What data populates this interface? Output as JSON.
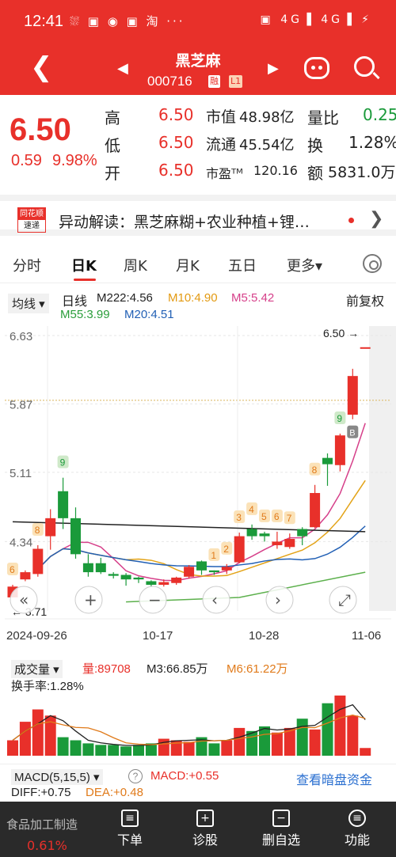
{
  "status": {
    "time": "12:41",
    "icons": "⛆ ▣ ◉ ▣ 淘 ···",
    "right": "▣ 4G▐ 4G▐ ⚡"
  },
  "nav": {
    "name": "黑芝麻",
    "code": "000716",
    "tag1": "融",
    "tag2": "L1",
    "back": "❮",
    "prev": "◀",
    "next": "▶"
  },
  "quote": {
    "price": "6.50",
    "change": "0.59",
    "pct": "9.98%",
    "high_label": "高",
    "high": "6.50",
    "low_label": "低",
    "low": "6.50",
    "open_label": "开",
    "open": "6.50",
    "mcap_label": "市值",
    "mcap": "48.98亿",
    "float_label": "流通",
    "float": "45.54亿",
    "pe_label": "市盈ᵀᴹ",
    "pe": "120.16",
    "vr_label": "量比",
    "vr": "0.25",
    "turn_label": "换",
    "turn": "1.28%",
    "amt_label": "额",
    "amt": "5831.0万"
  },
  "news": {
    "logo_top": "同花顺",
    "logo_bottom": "速递",
    "text": "异动解读：黑芝麻糊+农业种植+锂…",
    "chevron": "❯"
  },
  "tabs": [
    "分时",
    "日K",
    "周K",
    "月K",
    "五日",
    "更多▾"
  ],
  "ma": {
    "select": "均线 ▾",
    "line": "日线",
    "m222": "M222:4.56",
    "m10": "M10:4.90",
    "m5": "M5:5.42",
    "m55": "M55:3.99",
    "m20": "M20:4.51",
    "adj": "前复权"
  },
  "chart_data": {
    "type": "candlestick",
    "y_ticks": [
      "6.63",
      "5.87",
      "5.11",
      "4.34"
    ],
    "ylim": [
      3.57,
      6.63
    ],
    "dates": [
      "2024-09-26",
      "10-17",
      "10-28",
      "11-06"
    ],
    "max_label": "6.50",
    "min_label": "3.71",
    "candles": [
      [
        3.72,
        3.84,
        3.72,
        3.86
      ],
      [
        3.92,
        4.0,
        3.9,
        4.02
      ],
      [
        3.98,
        4.26,
        3.95,
        4.3
      ],
      [
        4.4,
        4.6,
        4.25,
        4.7
      ],
      [
        4.9,
        4.6,
        4.48,
        5.05
      ],
      [
        4.6,
        4.2,
        4.15,
        4.72
      ],
      [
        4.1,
        4.0,
        3.95,
        4.2
      ],
      [
        4.1,
        4.0,
        3.98,
        4.16
      ],
      [
        3.98,
        3.96,
        3.93,
        4.0
      ],
      [
        3.97,
        3.92,
        3.85,
        3.99
      ],
      [
        3.94,
        3.92,
        3.88,
        3.95
      ],
      [
        3.9,
        3.86,
        3.84,
        3.91
      ],
      [
        3.86,
        3.89,
        3.84,
        3.92
      ],
      [
        3.88,
        3.94,
        3.86,
        3.95
      ],
      [
        3.95,
        4.06,
        3.93,
        4.08
      ],
      [
        4.12,
        4.02,
        3.97,
        4.13
      ],
      [
        4.02,
        4.0,
        3.97,
        4.02
      ],
      [
        4.02,
        4.06,
        3.98,
        4.09
      ],
      [
        4.11,
        4.4,
        4.1,
        4.44
      ],
      [
        4.48,
        4.4,
        4.36,
        4.53
      ],
      [
        4.43,
        4.4,
        4.34,
        4.45
      ],
      [
        4.3,
        4.34,
        4.26,
        4.45
      ],
      [
        4.28,
        4.37,
        4.26,
        4.43
      ],
      [
        4.48,
        4.4,
        4.3,
        4.5
      ],
      [
        4.5,
        4.88,
        4.49,
        4.97
      ],
      [
        5.27,
        5.2,
        4.96,
        5.32
      ],
      [
        5.19,
        5.52,
        5.12,
        5.54
      ],
      [
        5.75,
        6.18,
        5.7,
        6.26
      ],
      [
        6.5,
        6.5,
        6.5,
        6.5
      ]
    ],
    "badges": [
      "6",
      "8",
      "9",
      "1",
      "2",
      "3",
      "4",
      "5",
      "6",
      "7",
      "8",
      "9"
    ]
  },
  "vol": {
    "select": "成交量 ▾",
    "vol": "量:89708",
    "m3": "M3:66.85万",
    "m6": "M6:61.22万",
    "turn": "换手率:1.28%",
    "values": [
      0.5,
      1.1,
      1.5,
      1.3,
      0.6,
      0.5,
      0.4,
      0.35,
      0.35,
      0.3,
      0.35,
      0.4,
      0.55,
      0.5,
      0.45,
      0.6,
      0.4,
      0.5,
      0.9,
      0.8,
      0.95,
      0.75,
      0.9,
      1.2,
      0.85,
      1.7,
      1.95,
      1.3,
      0.25
    ]
  },
  "macd": {
    "select": "MACD(5,15,5) ▾",
    "help": "?",
    "macd": "MACD:+0.55",
    "link": "查看暗盘资金",
    "diff": "DIFF:+0.75",
    "dea": "DEA:+0.48"
  },
  "bottom": {
    "ind": "食品加工制造",
    "ind_pct": "0.61%",
    "b1": "下单",
    "b2": "诊股",
    "b3": "删自选",
    "b4": "功能",
    "i1": "≡",
    "i2": "+",
    "i3": "−",
    "i4": "≡"
  }
}
